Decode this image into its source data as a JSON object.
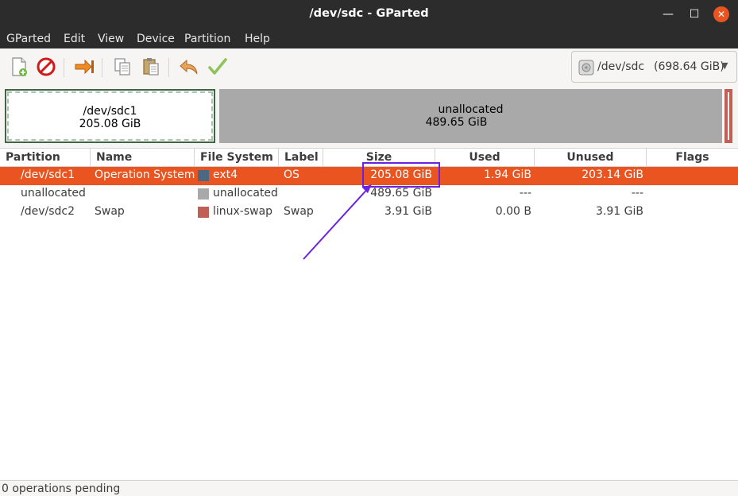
{
  "window": {
    "title": "/dev/sdc - GParted"
  },
  "menu": [
    "GParted",
    "Edit",
    "View",
    "Device",
    "Partition",
    "Help"
  ],
  "toolbar": {
    "icons": [
      "new-partition-icon",
      "delete-icon",
      "resize-move-icon",
      "copy-icon",
      "paste-icon",
      "undo-icon",
      "apply-icon"
    ]
  },
  "device": {
    "name": "/dev/sdc",
    "size": "(698.64 GiB)"
  },
  "map": {
    "seg1": {
      "name": "/dev/sdc1",
      "size": "205.08 GiB"
    },
    "seg2": {
      "name": "unallocated",
      "size": "489.65 GiB"
    }
  },
  "table": {
    "headers": [
      "Partition",
      "Name",
      "File System",
      "Label",
      "Size",
      "Used",
      "Unused",
      "Flags"
    ],
    "rows": [
      {
        "partition": "/dev/sdc1",
        "name": "Operation System",
        "fs": "ext4",
        "fs_color": "#4b6983",
        "label": "OS",
        "size": "205.08 GiB",
        "used": "1.94 GiB",
        "unused": "203.14 GiB",
        "flags": ""
      },
      {
        "partition": "unallocated",
        "name": "",
        "fs": "unallocated",
        "fs_color": "#a9a9a9",
        "label": "",
        "size": "489.65 GiB",
        "used": "---",
        "unused": "---",
        "flags": ""
      },
      {
        "partition": "/dev/sdc2",
        "name": "Swap",
        "fs": "linux-swap",
        "fs_color": "#c15f56",
        "label": "Swap",
        "size": "3.91 GiB",
        "used": "0.00 B",
        "unused": "3.91 GiB",
        "flags": ""
      }
    ]
  },
  "status": {
    "text": "0 operations pending"
  },
  "colors": {
    "accent": "#e95420",
    "annotation": "#6a22e0"
  }
}
